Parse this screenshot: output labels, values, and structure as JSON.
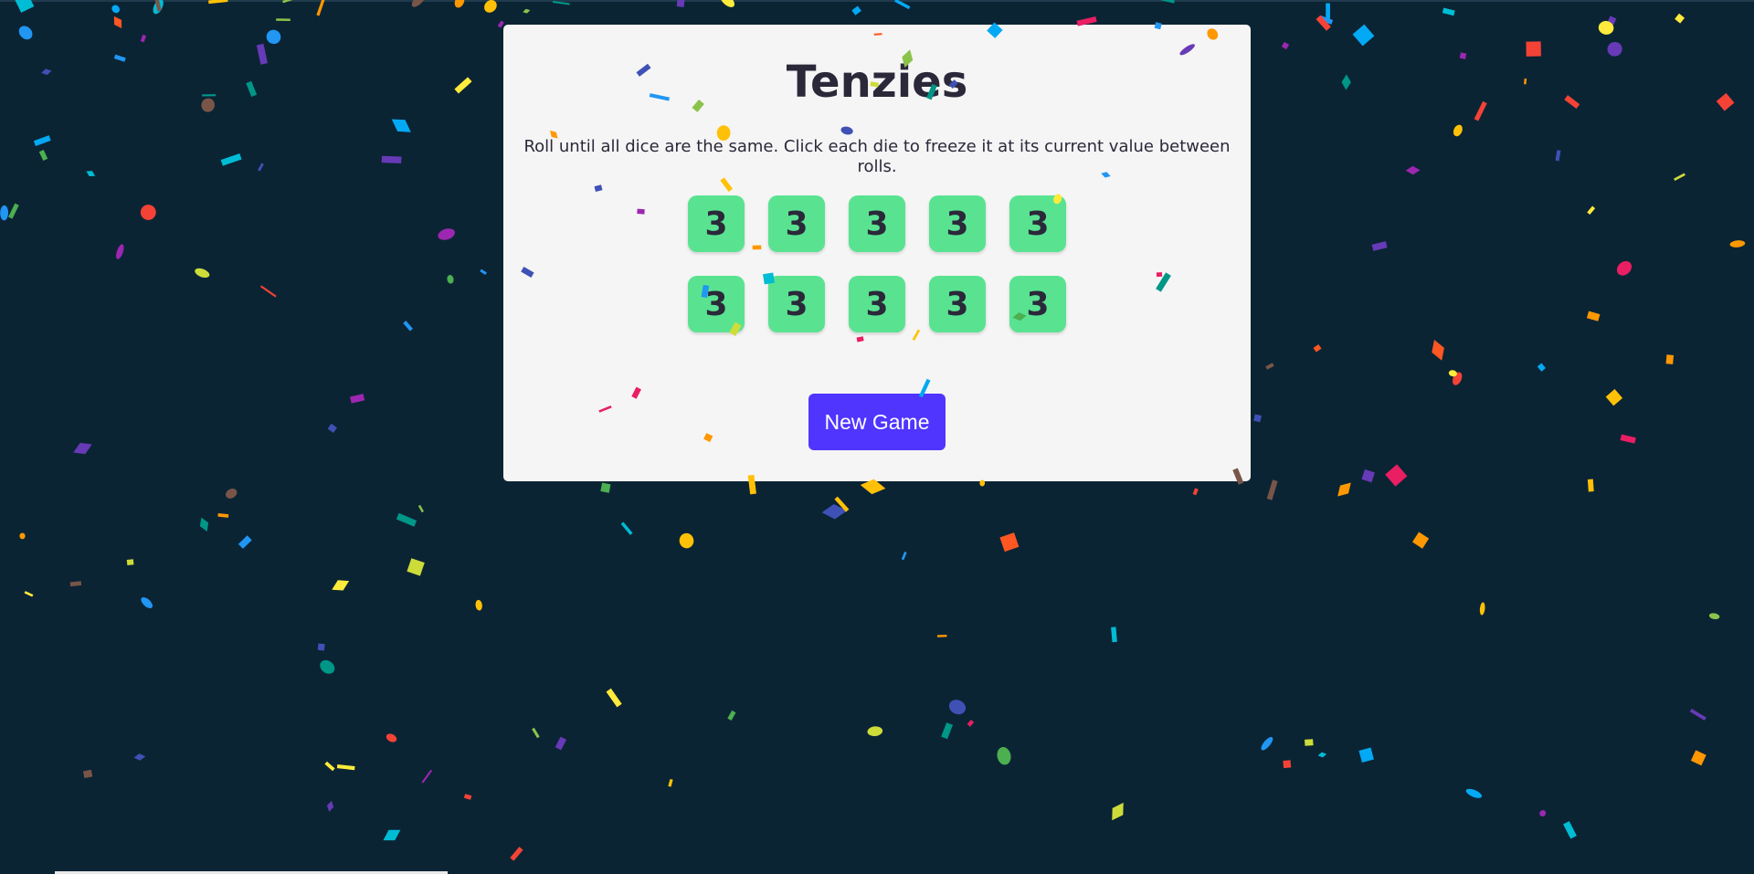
{
  "game": {
    "title": "Tenzies",
    "instructions": "Roll until all dice are the same. Click each die to freeze it at its current value between rolls.",
    "dice": [
      {
        "value": "3",
        "held": true
      },
      {
        "value": "3",
        "held": true
      },
      {
        "value": "3",
        "held": true
      },
      {
        "value": "3",
        "held": true
      },
      {
        "value": "3",
        "held": true
      },
      {
        "value": "3",
        "held": true
      },
      {
        "value": "3",
        "held": true
      },
      {
        "value": "3",
        "held": true
      },
      {
        "value": "3",
        "held": true
      },
      {
        "value": "3",
        "held": true
      }
    ],
    "button_label": "New Game",
    "won": true
  },
  "colors": {
    "background": "#0b2434",
    "panel": "#f5f5f5",
    "die_held": "#59e391",
    "die_free": "#ffffff",
    "button": "#5035ff",
    "text": "#2b283a",
    "confetti_palette": [
      "#f44336",
      "#e91e63",
      "#9c27b0",
      "#673ab7",
      "#3f51b5",
      "#2196f3",
      "#03a9f4",
      "#00bcd4",
      "#009688",
      "#4caf50",
      "#8bc34a",
      "#cddc39",
      "#ffeb3b",
      "#ffc107",
      "#ff9800",
      "#ff5722",
      "#795548"
    ]
  }
}
